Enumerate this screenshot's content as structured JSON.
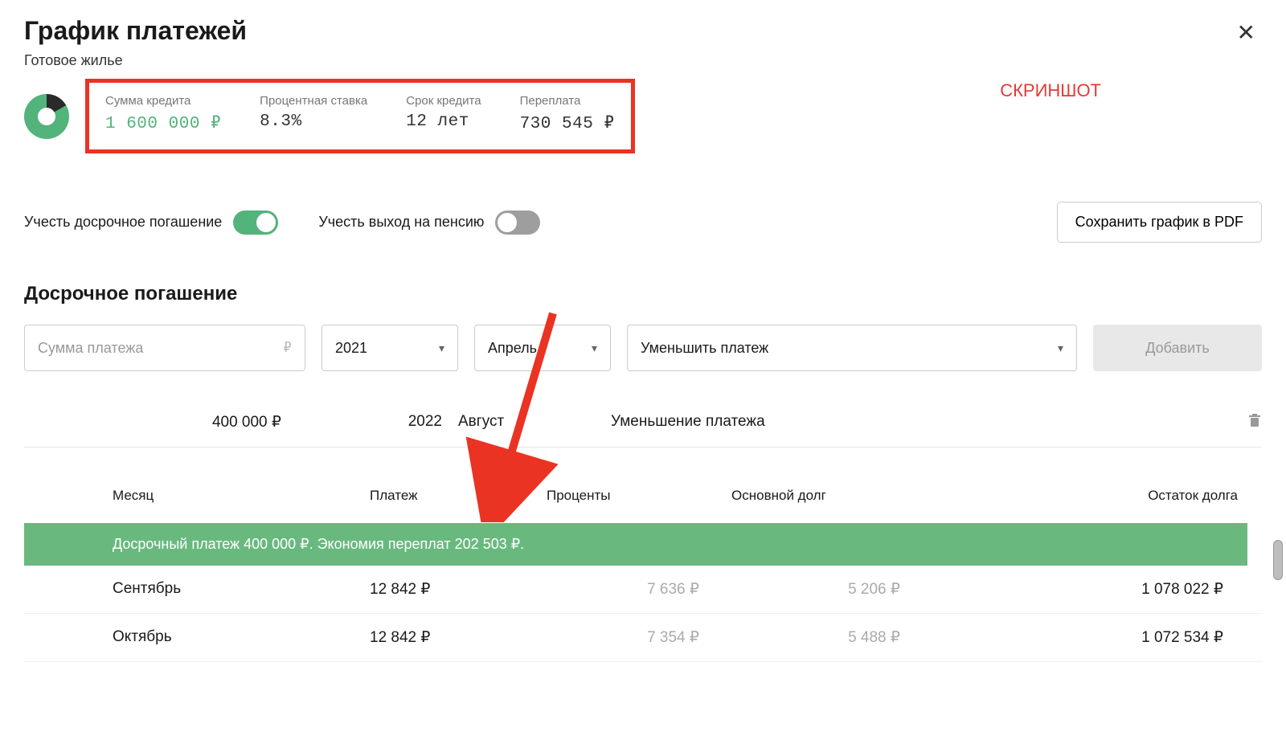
{
  "header": {
    "title": "График платежей",
    "subtitle": "Готовое жилье",
    "screenshot_label": "СКРИНШОТ"
  },
  "summary": {
    "loan_amount": {
      "label": "Сумма кредита",
      "value": "1 600 000 ₽"
    },
    "rate": {
      "label": "Процентная ставка",
      "value": "8.3%"
    },
    "term": {
      "label": "Срок кредита",
      "value": "12 лет"
    },
    "overpayment": {
      "label": "Переплата",
      "value": "730 545 ₽"
    }
  },
  "toggles": {
    "early": "Учесть досрочное погашение",
    "pension": "Учесть выход на пенсию",
    "pdf_button": "Сохранить график в PDF"
  },
  "early_section": {
    "title": "Досрочное погашение",
    "amount_placeholder": "Сумма платежа",
    "ruble_sign": "₽",
    "year": "2021",
    "month": "Апрель",
    "type": "Уменьшить платеж",
    "add_button": "Добавить"
  },
  "existing_payment": {
    "amount": "400 000 ₽",
    "year": "2022",
    "month": "Август",
    "type": "Уменьшение платежа"
  },
  "table": {
    "headers": {
      "month": "Месяц",
      "payment": "Платеж",
      "interest": "Проценты",
      "principal": "Основной долг",
      "balance": "Остаток долга"
    },
    "banner": "Досрочный платеж 400 000 ₽. Экономия переплат 202 503 ₽.",
    "rows": [
      {
        "month": "Сентябрь",
        "payment": "12 842 ₽",
        "interest": "7 636 ₽",
        "principal": "5 206 ₽",
        "balance": "1 078 022 ₽"
      },
      {
        "month": "Октябрь",
        "payment": "12 842 ₽",
        "interest": "7 354 ₽",
        "principal": "5 488 ₽",
        "balance": "1 072 534 ₽"
      }
    ]
  },
  "chart_data": {
    "type": "pie",
    "title": "",
    "series": [
      {
        "name": "Переплата",
        "value": 730545
      },
      {
        "name": "Сумма кредита",
        "value": 1600000
      }
    ]
  }
}
